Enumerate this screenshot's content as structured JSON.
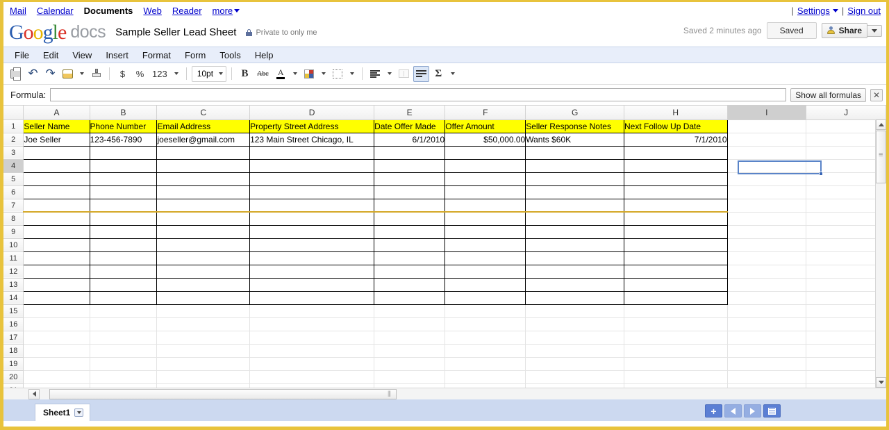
{
  "topnav": {
    "links": [
      "Mail",
      "Calendar"
    ],
    "current": "Documents",
    "links_after": [
      "Web",
      "Reader"
    ],
    "more_label": "more",
    "settings_label": "Settings",
    "signout_label": "Sign out",
    "sep": "|"
  },
  "header": {
    "logo_g1": "G",
    "logo_o1": "o",
    "logo_o2": "o",
    "logo_g2": "g",
    "logo_l": "l",
    "logo_e": "e",
    "docs_word": "docs",
    "doc_title": "Sample Seller Lead Sheet",
    "privacy": "Private to only me",
    "saved_status": "Saved 2 minutes ago",
    "saved_button": "Saved",
    "share_button": "Share"
  },
  "menubar": {
    "items": [
      "File",
      "Edit",
      "View",
      "Insert",
      "Format",
      "Form",
      "Tools",
      "Help"
    ]
  },
  "toolbar": {
    "print": "print-icon",
    "undo": "↶",
    "redo": "↷",
    "currency": "$",
    "percent": "%",
    "number_format": "123",
    "font_size": "10pt",
    "bold": "B",
    "strikethrough": "Abc",
    "text_color_letter": "A",
    "sigma": "Σ"
  },
  "formula": {
    "label": "Formula:",
    "value": "",
    "show_all_label": "Show all formulas",
    "close_label": "✕"
  },
  "grid": {
    "columns": [
      "A",
      "B",
      "C",
      "D",
      "E",
      "F",
      "G",
      "H",
      "I",
      "J"
    ],
    "selected_column": "I",
    "selected_row": 4,
    "selected_cell": "I4",
    "row_count": 23,
    "header_row": [
      "Seller Name",
      "Phone Number",
      "Email Address",
      "Property Street Address",
      "Date Offer Made",
      "Offer Amount",
      "Seller Response Notes",
      "Next Follow Up Date"
    ],
    "data_row": [
      "Joe Seller",
      "123-456-7890",
      "joeseller@gmail.com",
      "123 Main Street Chicago, IL",
      "6/1/2010",
      "$50,000.00",
      "Wants $60K",
      "7/1/2010"
    ],
    "data_row_align": [
      "left",
      "left",
      "left",
      "left",
      "right",
      "right",
      "left",
      "right"
    ],
    "header_fill_color": "#ffff00",
    "gold_rule_after_row": 7,
    "bordered_last_row": 14
  },
  "sheetbar": {
    "tab_label": "Sheet1",
    "add_sheet": "+",
    "prev_sheet": "◀",
    "next_sheet": "▶",
    "sheet_list": "list-icon"
  }
}
